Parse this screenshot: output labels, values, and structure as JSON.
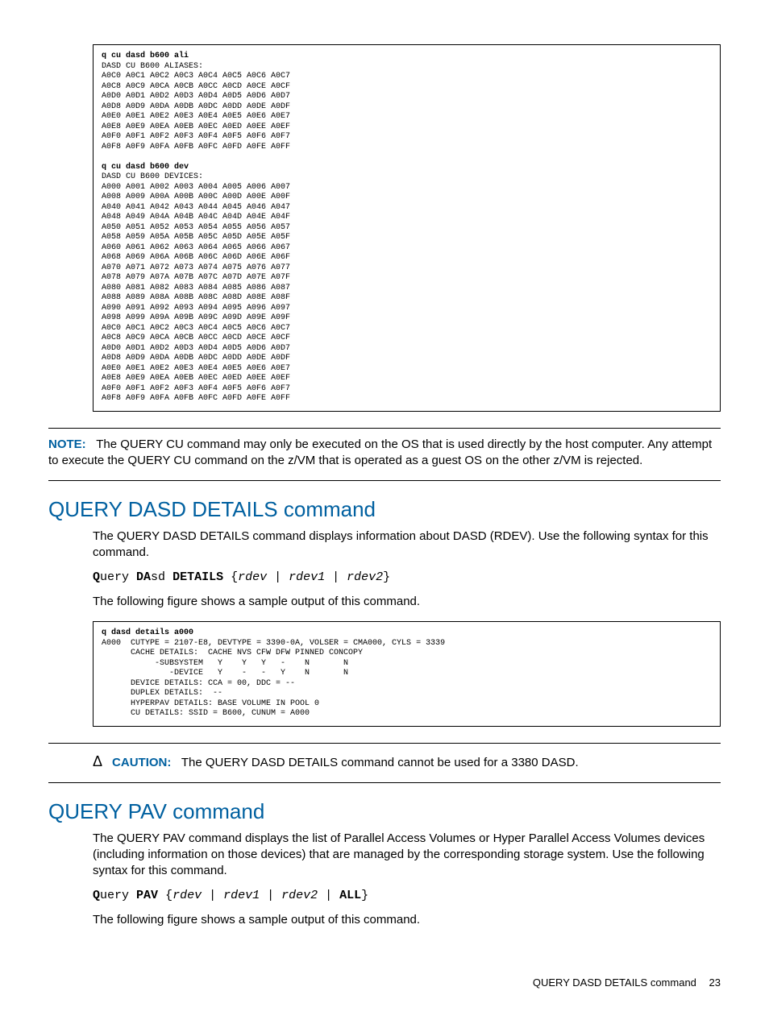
{
  "codebox1": {
    "cmd1_bold": "q cu dasd b600 ali",
    "aliases_header": "DASD CU B600 ALIASES:",
    "ali_lines": [
      "A0C0 A0C1 A0C2 A0C3 A0C4 A0C5 A0C6 A0C7",
      "A0C8 A0C9 A0CA A0CB A0CC A0CD A0CE A0CF",
      "A0D0 A0D1 A0D2 A0D3 A0D4 A0D5 A0D6 A0D7",
      "A0D8 A0D9 A0DA A0DB A0DC A0DD A0DE A0DF",
      "A0E0 A0E1 A0E2 A0E3 A0E4 A0E5 A0E6 A0E7",
      "A0E8 A0E9 A0EA A0EB A0EC A0ED A0EE A0EF",
      "A0F0 A0F1 A0F2 A0F3 A0F4 A0F5 A0F6 A0F7",
      "A0F8 A0F9 A0FA A0FB A0FC A0FD A0FE A0FF"
    ],
    "cmd2_bold": "q cu dasd b600 dev",
    "devices_header": "DASD CU B600 DEVICES:",
    "dev_lines": [
      "A000 A001 A002 A003 A004 A005 A006 A007",
      "A008 A009 A00A A00B A00C A00D A00E A00F",
      "A040 A041 A042 A043 A044 A045 A046 A047",
      "A048 A049 A04A A04B A04C A04D A04E A04F",
      "A050 A051 A052 A053 A054 A055 A056 A057",
      "A058 A059 A05A A05B A05C A05D A05E A05F",
      "A060 A061 A062 A063 A064 A065 A066 A067",
      "A068 A069 A06A A06B A06C A06D A06E A06F",
      "A070 A071 A072 A073 A074 A075 A076 A077",
      "A078 A079 A07A A07B A07C A07D A07E A07F",
      "A080 A081 A082 A083 A084 A085 A086 A087",
      "A088 A089 A08A A08B A08C A08D A08E A08F",
      "A090 A091 A092 A093 A094 A095 A096 A097",
      "A098 A099 A09A A09B A09C A09D A09E A09F",
      "A0C0 A0C1 A0C2 A0C3 A0C4 A0C5 A0C6 A0C7",
      "A0C8 A0C9 A0CA A0CB A0CC A0CD A0CE A0CF",
      "A0D0 A0D1 A0D2 A0D3 A0D4 A0D5 A0D6 A0D7",
      "A0D8 A0D9 A0DA A0DB A0DC A0DD A0DE A0DF",
      "A0E0 A0E1 A0E2 A0E3 A0E4 A0E5 A0E6 A0E7",
      "A0E8 A0E9 A0EA A0EB A0EC A0ED A0EE A0EF",
      "A0F0 A0F1 A0F2 A0F3 A0F4 A0F5 A0F6 A0F7",
      "A0F8 A0F9 A0FA A0FB A0FC A0FD A0FE A0FF"
    ]
  },
  "note": {
    "label": "NOTE:",
    "text": "The QUERY CU command may only be executed on the OS that is used directly by the host computer. Any attempt to execute the QUERY CU command on the z/VM that is operated as a guest OS on the other z/VM is rejected."
  },
  "sec_dasd": {
    "heading": "QUERY DASD DETAILS command",
    "intro": "The QUERY DASD DETAILS command displays information about DASD (RDEV). Use the following syntax for this command.",
    "syntax": {
      "q_bold": "Q",
      "q_rest": "uery ",
      "da_bold": "DA",
      "da_rest": "sd ",
      "det_bold": "DETAILS",
      "args": " {",
      "r1": "rdev",
      "bar1": " | ",
      "r2": "rdev1",
      "bar2": " | ",
      "r3": "rdev2",
      "end": "}"
    },
    "sample_text": "The following figure shows a sample output of this command."
  },
  "codebox2": {
    "cmd_bold": "q dasd details a000",
    "lines": [
      "A000  CUTYPE = 2107-E8, DEVTYPE = 3390-0A, VOLSER = CMA000, CYLS = 3339",
      "      CACHE DETAILS:  CACHE NVS CFW DFW PINNED CONCOPY",
      "           -SUBSYSTEM   Y    Y   Y   -    N       N",
      "              -DEVICE   Y    -   -   Y    N       N",
      "      DEVICE DETAILS: CCA = 00, DDC = --",
      "      DUPLEX DETAILS:  --",
      "      HYPERPAV DETAILS: BASE VOLUME IN POOL 0",
      "      CU DETAILS: SSID = B600, CUNUM = A000"
    ]
  },
  "caution": {
    "icon": "Δ",
    "label": "CAUTION:",
    "text": "The QUERY DASD DETAILS command cannot be used for a 3380 DASD."
  },
  "sec_pav": {
    "heading": "QUERY PAV command",
    "intro": "The QUERY PAV command displays the list of Parallel Access Volumes or Hyper Parallel Access Volumes devices (including information on those devices) that are managed by the corresponding storage system. Use the following syntax for this command.",
    "syntax": {
      "q_bold": "Q",
      "q_rest": "uery ",
      "pav_bold": "PAV",
      "args": " {",
      "r1": "rdev",
      "bar1": " | ",
      "r2": "rdev1",
      "bar2": " | ",
      "r3": "rdev2",
      "bar3": " | ",
      "all_bold": "ALL",
      "end": "}"
    },
    "sample_text": "The following figure shows a sample output of this command."
  },
  "footer": {
    "title": "QUERY DASD DETAILS command",
    "page": "23"
  }
}
